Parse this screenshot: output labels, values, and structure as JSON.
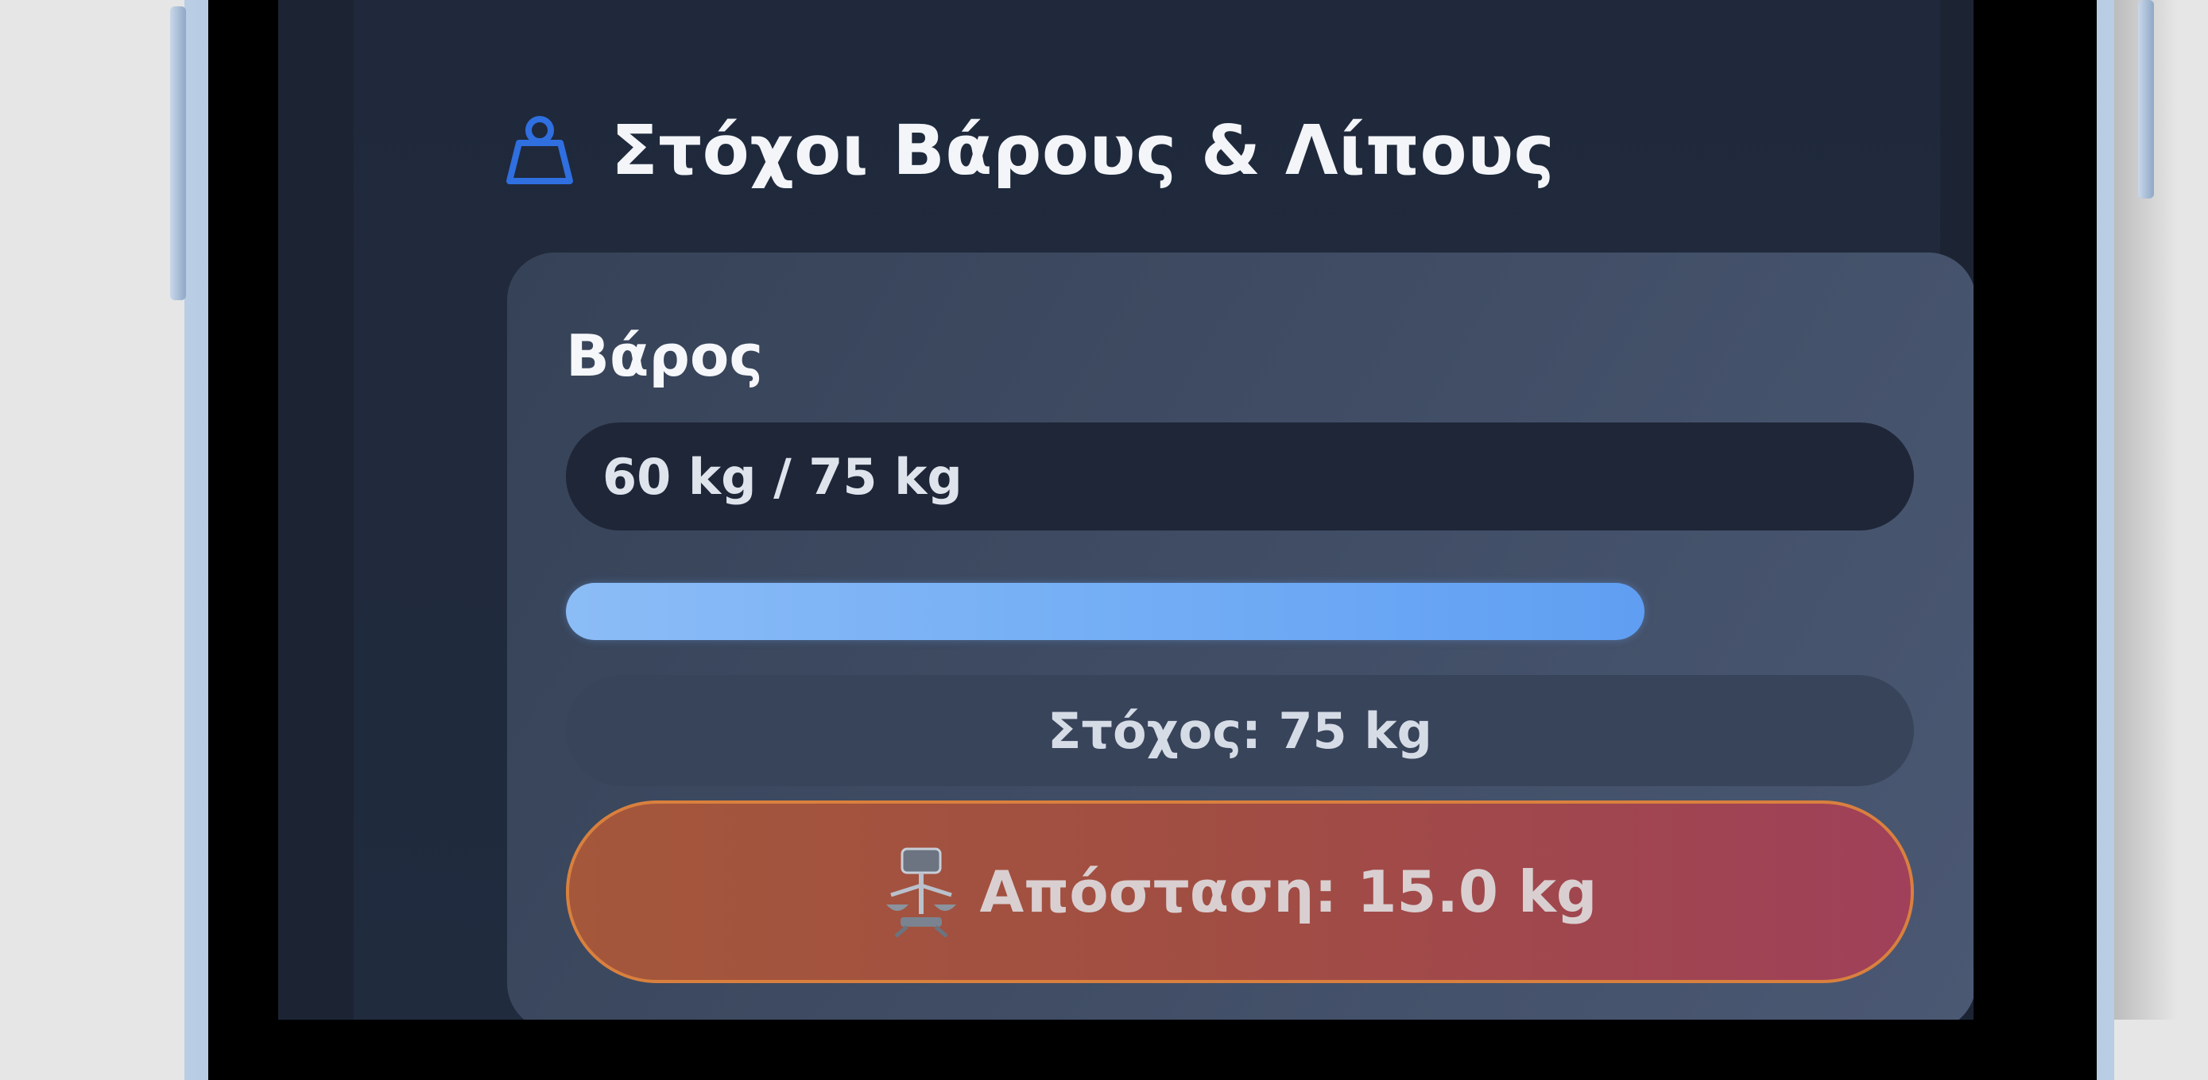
{
  "section": {
    "title": "Στόχοι Βάρους & Λίπους",
    "icon": "weight-icon"
  },
  "weight_card": {
    "title": "Βάρος",
    "current_value": "60 kg / 75 kg",
    "progress": 0.8,
    "target_label": "Στόχος: 75 kg",
    "distance_label": "Απόσταση: 15.0 kg",
    "distance_icon": "scale-icon"
  },
  "colors": {
    "accent": "#2f6fe0",
    "progress": "#6ea8f4",
    "warning_start": "#a4573b",
    "warning_end": "#a0405a"
  }
}
